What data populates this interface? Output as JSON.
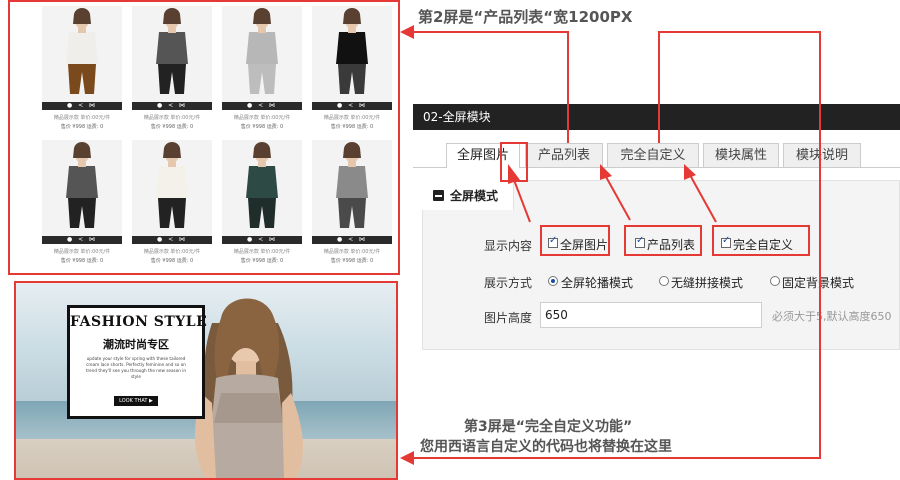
{
  "annotations": {
    "screen2": "第2屏是“产品列表“宽1200PX",
    "screen3_line1": "第3屏是“完全自定义功能”",
    "screen3_line2": "您用西语言自定义的代码也将替换在这里"
  },
  "products": {
    "action_bar": "● < ⋈",
    "items": [
      {
        "name": "精品展示款 单价:00元/件",
        "price": "售价 ¥998  运费: 0"
      },
      {
        "name": "精品展示款 单价:00元/件",
        "price": "售价 ¥998  运费: 0"
      },
      {
        "name": "精品展示款 单价:00元/件",
        "price": "售价 ¥998  运费: 0"
      },
      {
        "name": "精品展示款 单价:00元/件",
        "price": "售价 ¥998  运费: 0"
      },
      {
        "name": "精品展示款 单价:00元/件",
        "price": "售价 ¥998  运费: 0"
      },
      {
        "name": "精品展示款 单价:00元/件",
        "price": "售价 ¥998  运费: 0"
      },
      {
        "name": "精品展示款 单价:00元/件",
        "price": "售价 ¥998  运费: 0"
      },
      {
        "name": "精品展示款 单价:00元/件",
        "price": "售价 ¥998  运费: 0"
      }
    ]
  },
  "banner": {
    "title": "FASHION STYLE",
    "subtitle": "潮流时尚专区",
    "description": "update your style for spring with these tailored cream lace shorts. Perfectly feminine and so on trend they'll see you through the new season in style",
    "button": "LOOK THAT ▶"
  },
  "module": {
    "header": "02-全屏模块",
    "tabs": [
      "全屏图片",
      "产品列表",
      "完全自定义",
      "模块属性",
      "模块说明"
    ],
    "active_tab": "全屏图片",
    "section_title": "全屏模式",
    "display_content": {
      "label": "显示内容",
      "options": [
        {
          "label": "全屏图片",
          "checked": true
        },
        {
          "label": "产品列表",
          "checked": true
        },
        {
          "label": "完全自定义",
          "checked": true
        }
      ]
    },
    "display_mode": {
      "label": "展示方式",
      "options": [
        {
          "label": "全屏轮播模式",
          "selected": true
        },
        {
          "label": "无缝拼接模式",
          "selected": false
        },
        {
          "label": "固定背景模式",
          "selected": false
        }
      ]
    },
    "image_height": {
      "label": "图片高度",
      "value": "650",
      "hint": "必须大于5,默认高度650"
    }
  },
  "colors": {
    "annotation_red": "#e53935",
    "header_bg": "#222222",
    "panel_bg": "#f4f4f4"
  }
}
